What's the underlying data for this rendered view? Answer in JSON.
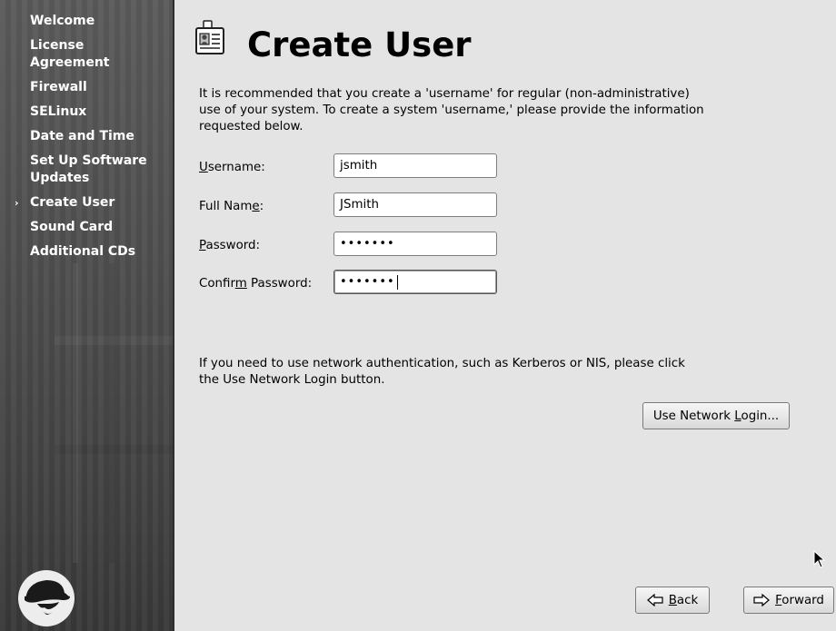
{
  "sidebar": {
    "items": [
      {
        "label": "Welcome",
        "current": false
      },
      {
        "label": "License Agreement",
        "current": false
      },
      {
        "label": "Firewall",
        "current": false
      },
      {
        "label": "SELinux",
        "current": false
      },
      {
        "label": "Date and Time",
        "current": false
      },
      {
        "label": "Set Up Software Updates",
        "current": false
      },
      {
        "label": "Create User",
        "current": true
      },
      {
        "label": "Sound Card",
        "current": false
      },
      {
        "label": "Additional CDs",
        "current": false
      }
    ],
    "current_marker": "›",
    "logo_icon": "red-hat-shadowman-icon"
  },
  "page": {
    "title": "Create User",
    "title_icon": "id-badge-icon",
    "intro": "It is recommended that you create a 'username' for regular (non-administrative) use of your system. To create a system 'username,' please provide the information requested below."
  },
  "form": {
    "username": {
      "label_before": "",
      "label_mnemonic": "U",
      "label_after": "sername:",
      "value": "jsmith"
    },
    "fullname": {
      "label_before": "Full Nam",
      "label_mnemonic": "e",
      "label_after": ":",
      "value": "JSmith"
    },
    "password": {
      "label_before": "",
      "label_mnemonic": "P",
      "label_after": "assword:",
      "value": "•••••••"
    },
    "confirm": {
      "label_before": "Confir",
      "label_mnemonic": "m",
      "label_after": " Password:",
      "value": "•••••••"
    }
  },
  "network": {
    "text": "If you need to use network authentication, such as Kerberos or NIS, please click the Use Network Login button.",
    "button_before": "Use Network ",
    "button_mnemonic": "L",
    "button_after": "ogin..."
  },
  "footer": {
    "back_mnemonic": "B",
    "back_rest": "ack",
    "forward_mnemonic": "F",
    "forward_rest": "orward",
    "back_icon": "arrow-left-icon",
    "forward_icon": "arrow-right-icon"
  },
  "colors": {
    "sidebar_bg": "#4f4f4f",
    "main_bg": "#e4e4e4",
    "accent": "#cc0000"
  }
}
